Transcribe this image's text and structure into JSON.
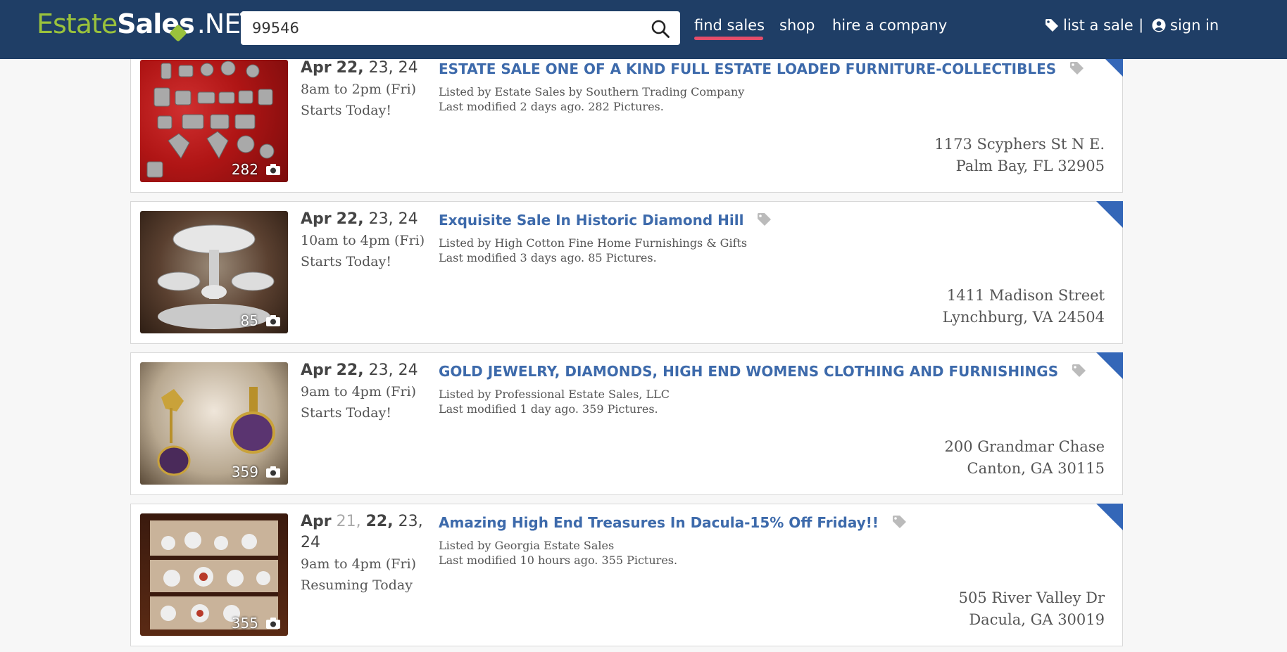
{
  "header": {
    "logo": {
      "part1": "Estate",
      "part2": "Sales",
      "part3": ".NET"
    },
    "search": {
      "value": "99546",
      "placeholder": ""
    },
    "nav": {
      "find_sales": "find sales",
      "shop": "shop",
      "hire_company": "hire a company",
      "list_sale": "list a sale",
      "separator": "|",
      "sign_in": "sign in"
    }
  },
  "colors": {
    "header_bg": "#1f3e66",
    "accent_green": "#9ac23c",
    "link_blue": "#3d6aab",
    "active_underline": "#e54d6a",
    "corner_flag": "#3467b8"
  },
  "listings": [
    {
      "dates": {
        "month": "Apr",
        "bold": "22,",
        "rest": "23, 24"
      },
      "time": "8am to 2pm (Fri)",
      "status": "Starts Today!",
      "title": "ESTATE SALE ONE OF A KIND FULL ESTATE LOADED FURNITURE-COLLECTIBLES",
      "listed_by": "Listed by Estate Sales by Southern Trading Company",
      "modified": "Last modified 2 days ago. 282 Pictures.",
      "address_line1": "1173 Scyphers St N E.",
      "address_line2": "Palm Bay, FL 32905",
      "photo_count": "282"
    },
    {
      "dates": {
        "month": "Apr",
        "bold": "22,",
        "rest": "23, 24"
      },
      "time": "10am to 4pm (Fri)",
      "status": "Starts Today!",
      "title": "Exquisite Sale In Historic Diamond Hill",
      "listed_by": "Listed by High Cotton Fine Home Furnishings & Gifts",
      "modified": "Last modified 3 days ago. 85 Pictures.",
      "address_line1": "1411 Madison Street",
      "address_line2": "Lynchburg, VA 24504",
      "photo_count": "85"
    },
    {
      "dates": {
        "month": "Apr",
        "bold": "22,",
        "rest": "23, 24"
      },
      "time": "9am to 4pm (Fri)",
      "status": "Starts Today!",
      "title": "GOLD JEWELRY, DIAMONDS, HIGH END WOMENS CLOTHING AND FURNISHINGS",
      "listed_by": "Listed by Professional Estate Sales, LLC",
      "modified": "Last modified 1 day ago. 359 Pictures.",
      "address_line1": "200 Grandmar Chase",
      "address_line2": "Canton, GA 30115",
      "photo_count": "359"
    },
    {
      "dates": {
        "month": "Apr",
        "dim": "21,",
        "bold": "22,",
        "rest": "23,",
        "rest2": "24"
      },
      "time": "9am to 4pm (Fri)",
      "status": "Resuming Today",
      "title": "Amazing High End Treasures In Dacula-15% Off Friday!!",
      "listed_by": "Listed by Georgia Estate Sales",
      "modified": "Last modified 10 hours ago. 355 Pictures.",
      "address_line1": "505 River Valley Dr",
      "address_line2": "Dacula, GA 30019",
      "photo_count": "355"
    }
  ]
}
